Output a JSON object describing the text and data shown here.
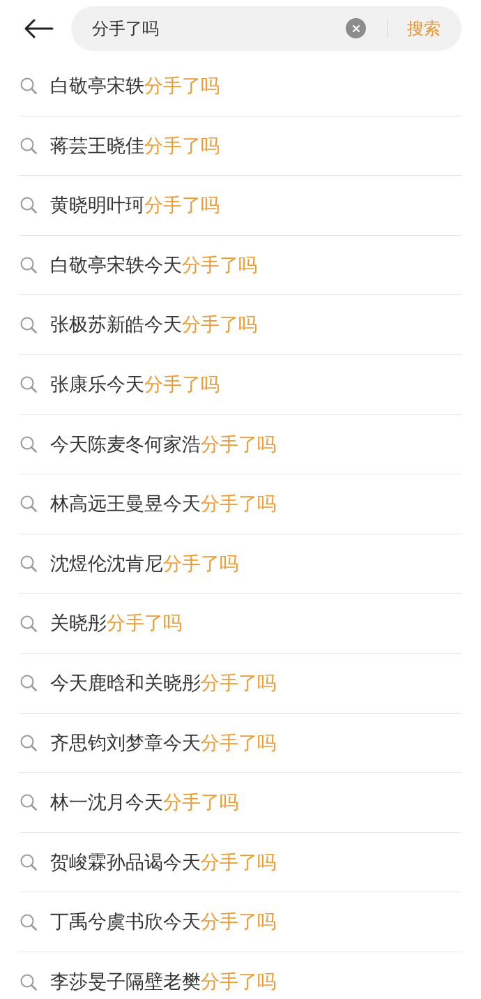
{
  "search_bar": {
    "query": "分手了吗",
    "search_button": "搜索"
  },
  "suggestions": [
    {
      "text": "白敬亭宋轶",
      "match": "分手了吗"
    },
    {
      "text": "蒋芸王晓佳",
      "match": "分手了吗"
    },
    {
      "text": "黄晓明叶珂",
      "match": "分手了吗"
    },
    {
      "text": "白敬亭宋轶今天",
      "match": "分手了吗"
    },
    {
      "text": "张极苏新皓今天",
      "match": "分手了吗"
    },
    {
      "text": "张康乐今天",
      "match": "分手了吗"
    },
    {
      "text": "今天陈麦冬何家浩",
      "match": "分手了吗"
    },
    {
      "text": "林高远王曼昱今天",
      "match": "分手了吗"
    },
    {
      "text": "沈煜伦沈肯尼",
      "match": "分手了吗"
    },
    {
      "text": "关晓彤",
      "match": "分手了吗"
    },
    {
      "text": "今天鹿晗和关晓彤",
      "match": "分手了吗"
    },
    {
      "text": "齐思钧刘梦章今天",
      "match": "分手了吗"
    },
    {
      "text": "林一沈月今天",
      "match": "分手了吗"
    },
    {
      "text": "贺峻霖孙品谒今天",
      "match": "分手了吗"
    },
    {
      "text": "丁禹兮虞书欣今天",
      "match": "分手了吗"
    },
    {
      "text": "李莎旻子隔壁老樊",
      "match": "分手了吗"
    }
  ]
}
